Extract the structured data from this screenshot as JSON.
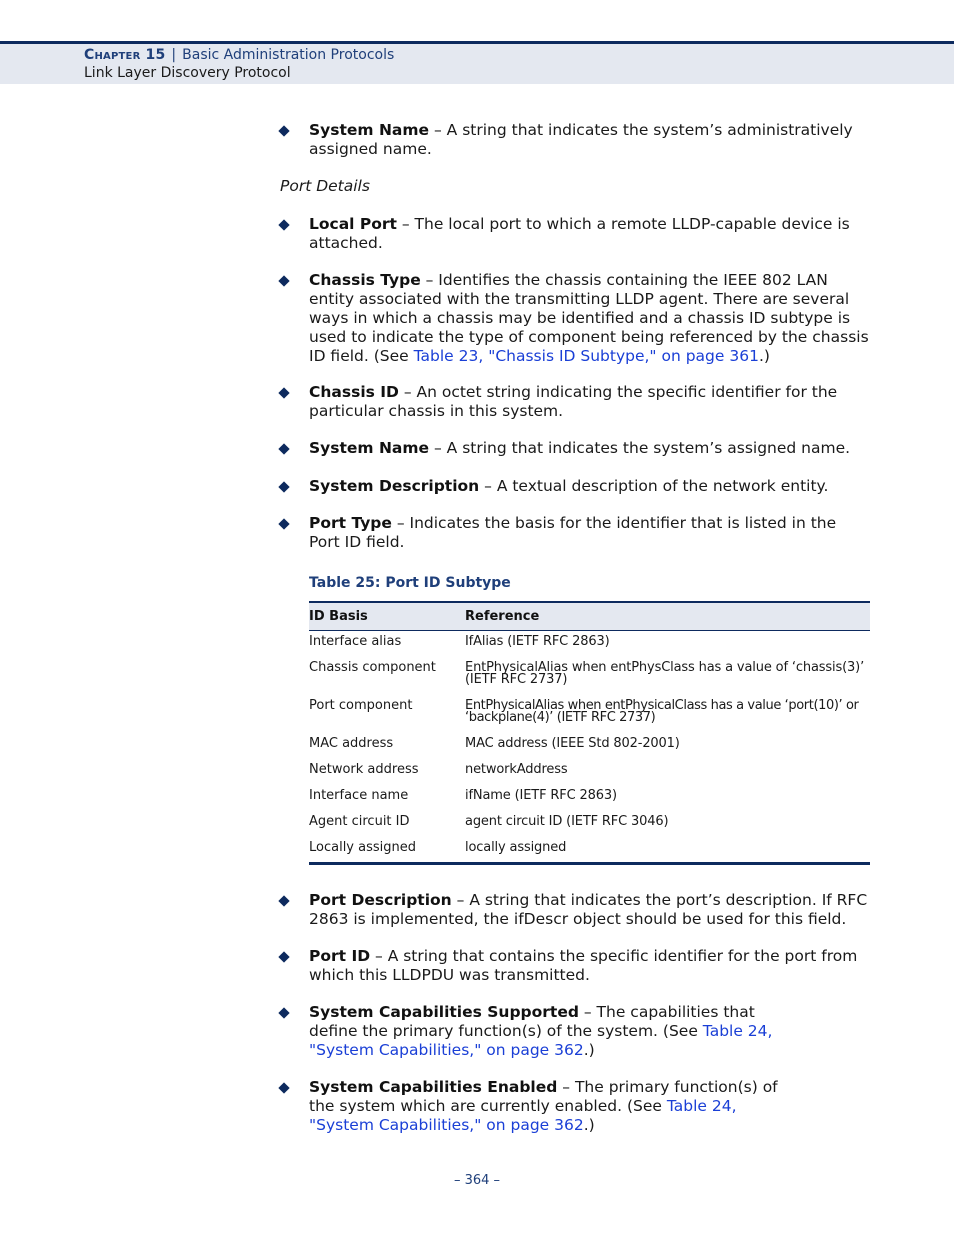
{
  "header": {
    "chapter_label": "Chapter 15",
    "separator": "|",
    "chapter_title": "Basic Administration Protocols",
    "section_title": "Link Layer Discovery Protocol"
  },
  "bullets_top": [
    {
      "term": "System Name",
      "desc": " – A string that indicates the system’s administratively assigned name."
    }
  ],
  "subheading": "Port Details",
  "bullets_port": [
    {
      "term": "Local Port",
      "desc": " – The local port to which a remote LLDP-capable device is attached."
    },
    {
      "term": "Chassis Type",
      "desc": " – Identifies the chassis containing the IEEE 802 LAN entity associated with the transmitting LLDP agent. There are several ways in which a chassis may be identified and a chassis ID subtype is used to indicate the type of component being referenced by the chassis ID field. (See ",
      "link": "Table 23, \"Chassis ID Subtype,\" on page 361",
      "after": ".)"
    },
    {
      "term": "Chassis ID",
      "desc": " – An octet string indicating the specific identifier for the particular chassis in this system."
    },
    {
      "term": "System Name",
      "desc": " – A string that indicates the system’s assigned name."
    },
    {
      "term": "System Description",
      "desc": " – A textual description of the network entity."
    },
    {
      "term": "Port Type",
      "desc": " – Indicates the basis for the identifier that is listed in the Port ID field."
    }
  ],
  "table": {
    "caption": "Table 25: Port ID Subtype",
    "headers": [
      "ID Basis",
      "Reference"
    ],
    "rows": [
      [
        "Interface alias",
        "IfAlias (IETF RFC 2863)"
      ],
      [
        "Chassis component",
        "EntPhysicalAlias when entPhysClass has a value of ‘chassis(3)’ (IETF RFC 2737)"
      ],
      [
        "Port component",
        "EntPhysicalAlias when entPhysicalClass has a value ‘port(10)’ or ‘backplane(4)’ (IETF RFC 2737)"
      ],
      [
        "MAC address",
        "MAC address (IEEE Std 802-2001)"
      ],
      [
        "Network address",
        "networkAddress"
      ],
      [
        "Interface name",
        "ifName (IETF RFC 2863)"
      ],
      [
        "Agent circuit ID",
        "agent circuit ID (IETF RFC 3046)"
      ],
      [
        "Locally assigned",
        "locally assigned"
      ]
    ]
  },
  "bullets_bottom": [
    {
      "term": "Port Description",
      "desc": " – A string that indicates the port’s description. If RFC 2863 is implemented, the ifDescr object should be used for this field."
    },
    {
      "term": "Port ID",
      "desc": " – A string that contains the specific identifier for the port from which this LLDPDU was transmitted."
    },
    {
      "term": "System Capabilities Supported",
      "desc": " – The capabilities that define the primary function(s) of the system. (See ",
      "link": "Table 24, \"System Capabilities,\" on page 362",
      "after": ".)"
    },
    {
      "term": "System Capabilities Enabled",
      "desc": " – The primary function(s) of the system which are currently enabled. (See ",
      "link": "Table 24, \"System Capabilities,\" on page 362",
      "after": ".)"
    }
  ],
  "footer": {
    "page_number": "–  364  –"
  },
  "colors": {
    "accent": "#0d2a5e",
    "heading": "#1f3f7a",
    "link": "#1a3fd6",
    "header_bg": "#e4e8f0"
  }
}
